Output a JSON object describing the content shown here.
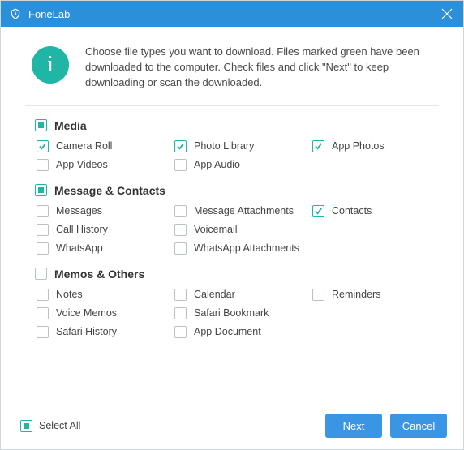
{
  "app": {
    "title": "FoneLab"
  },
  "hero": {
    "text": "Choose file types you want to download. Files marked green have been downloaded to the computer. Check files and click \"Next\" to keep downloading or scan the downloaded."
  },
  "groups": {
    "media": {
      "label": "Media",
      "state": "partial",
      "items": {
        "camera_roll": {
          "label": "Camera Roll",
          "state": "checked"
        },
        "photo_library": {
          "label": "Photo Library",
          "state": "checked"
        },
        "app_photos": {
          "label": "App Photos",
          "state": "checked"
        },
        "app_videos": {
          "label": "App Videos",
          "state": "unchecked"
        },
        "app_audio": {
          "label": "App Audio",
          "state": "unchecked"
        }
      }
    },
    "contacts": {
      "label": "Message & Contacts",
      "state": "partial",
      "items": {
        "messages": {
          "label": "Messages",
          "state": "unchecked"
        },
        "msg_attach": {
          "label": "Message Attachments",
          "state": "unchecked"
        },
        "contacts": {
          "label": "Contacts",
          "state": "checked"
        },
        "call_history": {
          "label": "Call History",
          "state": "unchecked"
        },
        "voicemail": {
          "label": "Voicemail",
          "state": "unchecked"
        },
        "whatsapp": {
          "label": "WhatsApp",
          "state": "unchecked"
        },
        "wa_attach": {
          "label": "WhatsApp Attachments",
          "state": "unchecked"
        }
      }
    },
    "memos": {
      "label": "Memos & Others",
      "state": "unchecked",
      "items": {
        "notes": {
          "label": "Notes",
          "state": "unchecked"
        },
        "calendar": {
          "label": "Calendar",
          "state": "unchecked"
        },
        "reminders": {
          "label": "Reminders",
          "state": "unchecked"
        },
        "voice_memos": {
          "label": "Voice Memos",
          "state": "unchecked"
        },
        "safari_bm": {
          "label": "Safari Bookmark",
          "state": "unchecked"
        },
        "safari_hist": {
          "label": "Safari History",
          "state": "unchecked"
        },
        "app_document": {
          "label": "App Document",
          "state": "unchecked"
        }
      }
    }
  },
  "footer": {
    "select_all": {
      "label": "Select All",
      "state": "partial"
    },
    "next_label": "Next",
    "cancel_label": "Cancel"
  },
  "colors": {
    "primary_teal": "#1fb6a6",
    "primary_blue": "#2b90d9",
    "button_blue": "#3a95e4"
  }
}
